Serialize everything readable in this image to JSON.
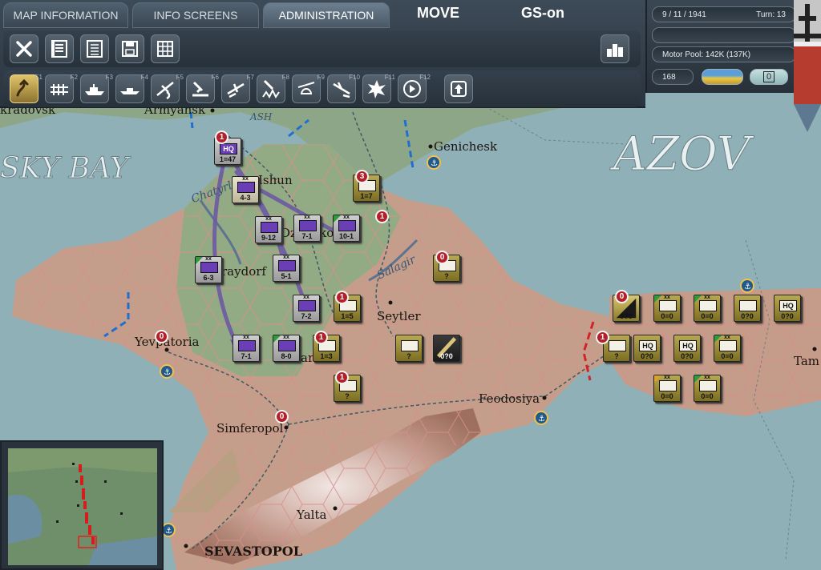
{
  "tabs": [
    {
      "label": "MAP INFORMATION"
    },
    {
      "label": "INFO SCREENS"
    },
    {
      "label": "ADMINISTRATION"
    }
  ],
  "mode_label": "MOVE",
  "gs_label": "GS-on",
  "status": {
    "date": "9 / 11 / 1941",
    "turn": "Turn: 13",
    "motor_pool": "Motor Pool:  142K (137K)",
    "counter": "168",
    "indicator": "0"
  },
  "toolbar_top": [
    "close-icon",
    "unit-list-icon",
    "list-icon",
    "save-icon",
    "grid-icon"
  ],
  "toolbar_bottom": [
    {
      "icon": "move-icon",
      "fkey": "F1"
    },
    {
      "icon": "rail-icon",
      "fkey": "F2"
    },
    {
      "icon": "ship-icon",
      "fkey": "F3"
    },
    {
      "icon": "naval-icon",
      "fkey": "F4"
    },
    {
      "icon": "air-transport-icon",
      "fkey": "F5"
    },
    {
      "icon": "artillery-icon",
      "fkey": "F6"
    },
    {
      "icon": "air-strike-icon",
      "fkey": "F7"
    },
    {
      "icon": "bombard-icon",
      "fkey": "F8"
    },
    {
      "icon": "paradrop-icon",
      "fkey": "F9"
    },
    {
      "icon": "interdict-icon",
      "fkey": "F10"
    },
    {
      "icon": "explosion-icon",
      "fkey": "F11"
    },
    {
      "icon": "next-icon",
      "fkey": "F12"
    }
  ],
  "map_labels": {
    "cities": [
      "Armyansk",
      "Genichesk",
      "Ishun",
      "Seytler",
      "Yevpatoria",
      "Simferopol",
      "Feodosiya",
      "Yalta",
      "SEVASTOPOL",
      "Tam"
    ],
    "partial": [
      "kradovsk",
      "raydorf",
      "Dzhankoy",
      "ar"
    ],
    "water": [
      "SKY BAY",
      "AZOV"
    ],
    "rivers": [
      "Chatyrlyk",
      "Salagir",
      "ASH"
    ]
  },
  "units_axis": [
    {
      "str": "1=47",
      "badge": "1",
      "hq": true
    },
    {
      "str": "4-3"
    },
    {
      "str": "9-12"
    },
    {
      "str": "7-1"
    },
    {
      "str": "10-1"
    },
    {
      "str": "6-3"
    },
    {
      "str": "5-1"
    },
    {
      "str": "7-2"
    },
    {
      "str": "7-1"
    },
    {
      "str": "8-0"
    }
  ],
  "units_soviet": [
    {
      "str": "1=7",
      "badge": "3"
    },
    {
      "str": "?",
      "badge": "0"
    },
    {
      "str": "1=5",
      "badge": "1"
    },
    {
      "str": "?"
    },
    {
      "str": "0?0"
    },
    {
      "str": "1=3",
      "badge": "1"
    },
    {
      "str": "?",
      "badge": "1"
    },
    {
      "str": "0?0",
      "badge": "0"
    },
    {
      "str": "0=0"
    },
    {
      "str": "0=0"
    },
    {
      "str": "0?0"
    },
    {
      "str": "0?0",
      "hq_label": "HQ"
    },
    {
      "str": "?",
      "badge": "1"
    },
    {
      "str": "0?0",
      "hq_label": "HQ"
    },
    {
      "str": "0?0",
      "hq_label": "HQ"
    },
    {
      "str": "0=0"
    },
    {
      "str": "0=0"
    },
    {
      "str": "0=0"
    }
  ],
  "other_badges": [
    "1",
    "0"
  ]
}
